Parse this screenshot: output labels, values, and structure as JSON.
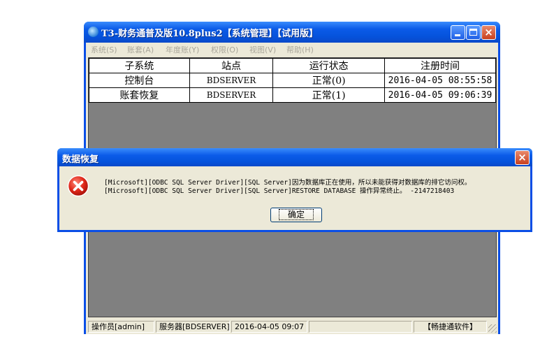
{
  "window": {
    "title": "T3-财务通普及版10.8plus2【系统管理】【试用版】",
    "controls": {
      "minimize": "minimize",
      "maximize": "maximize",
      "close": "×"
    }
  },
  "menu": [
    {
      "label": "系统(S)"
    },
    {
      "label": "账套(A)"
    },
    {
      "label": "年度账(Y)"
    },
    {
      "label": "权限(O)"
    },
    {
      "label": "视图(V)"
    },
    {
      "label": "帮助(H)"
    }
  ],
  "table": {
    "columns": [
      "子系统",
      "站点",
      "运行状态",
      "注册时间"
    ],
    "rows": [
      [
        "控制台",
        "BDSERVER",
        "正常(0)",
        "2016-04-05 08:55:58"
      ],
      [
        "账套恢复",
        "BDSERVER",
        "正常(1)",
        "2016-04-05 09:06:39"
      ]
    ]
  },
  "statusbar": {
    "operator": "操作员[admin]",
    "server": "服务器[BDSERVER]",
    "datetime": "2016-04-05 09:07",
    "company": "【畅捷通软件】"
  },
  "dialog": {
    "title": "数据恢复",
    "icon": "error-icon",
    "message_line1": "[Microsoft][ODBC SQL Server Driver][SQL Server]因为数据库正在使用，所以未能获得对数据库的排它访问权。",
    "message_line2": "[Microsoft][ODBC SQL Server Driver][SQL Server]RESTORE DATABASE 操作异常终止。 -2147218403",
    "ok_label": "确定",
    "close_label": "×"
  }
}
